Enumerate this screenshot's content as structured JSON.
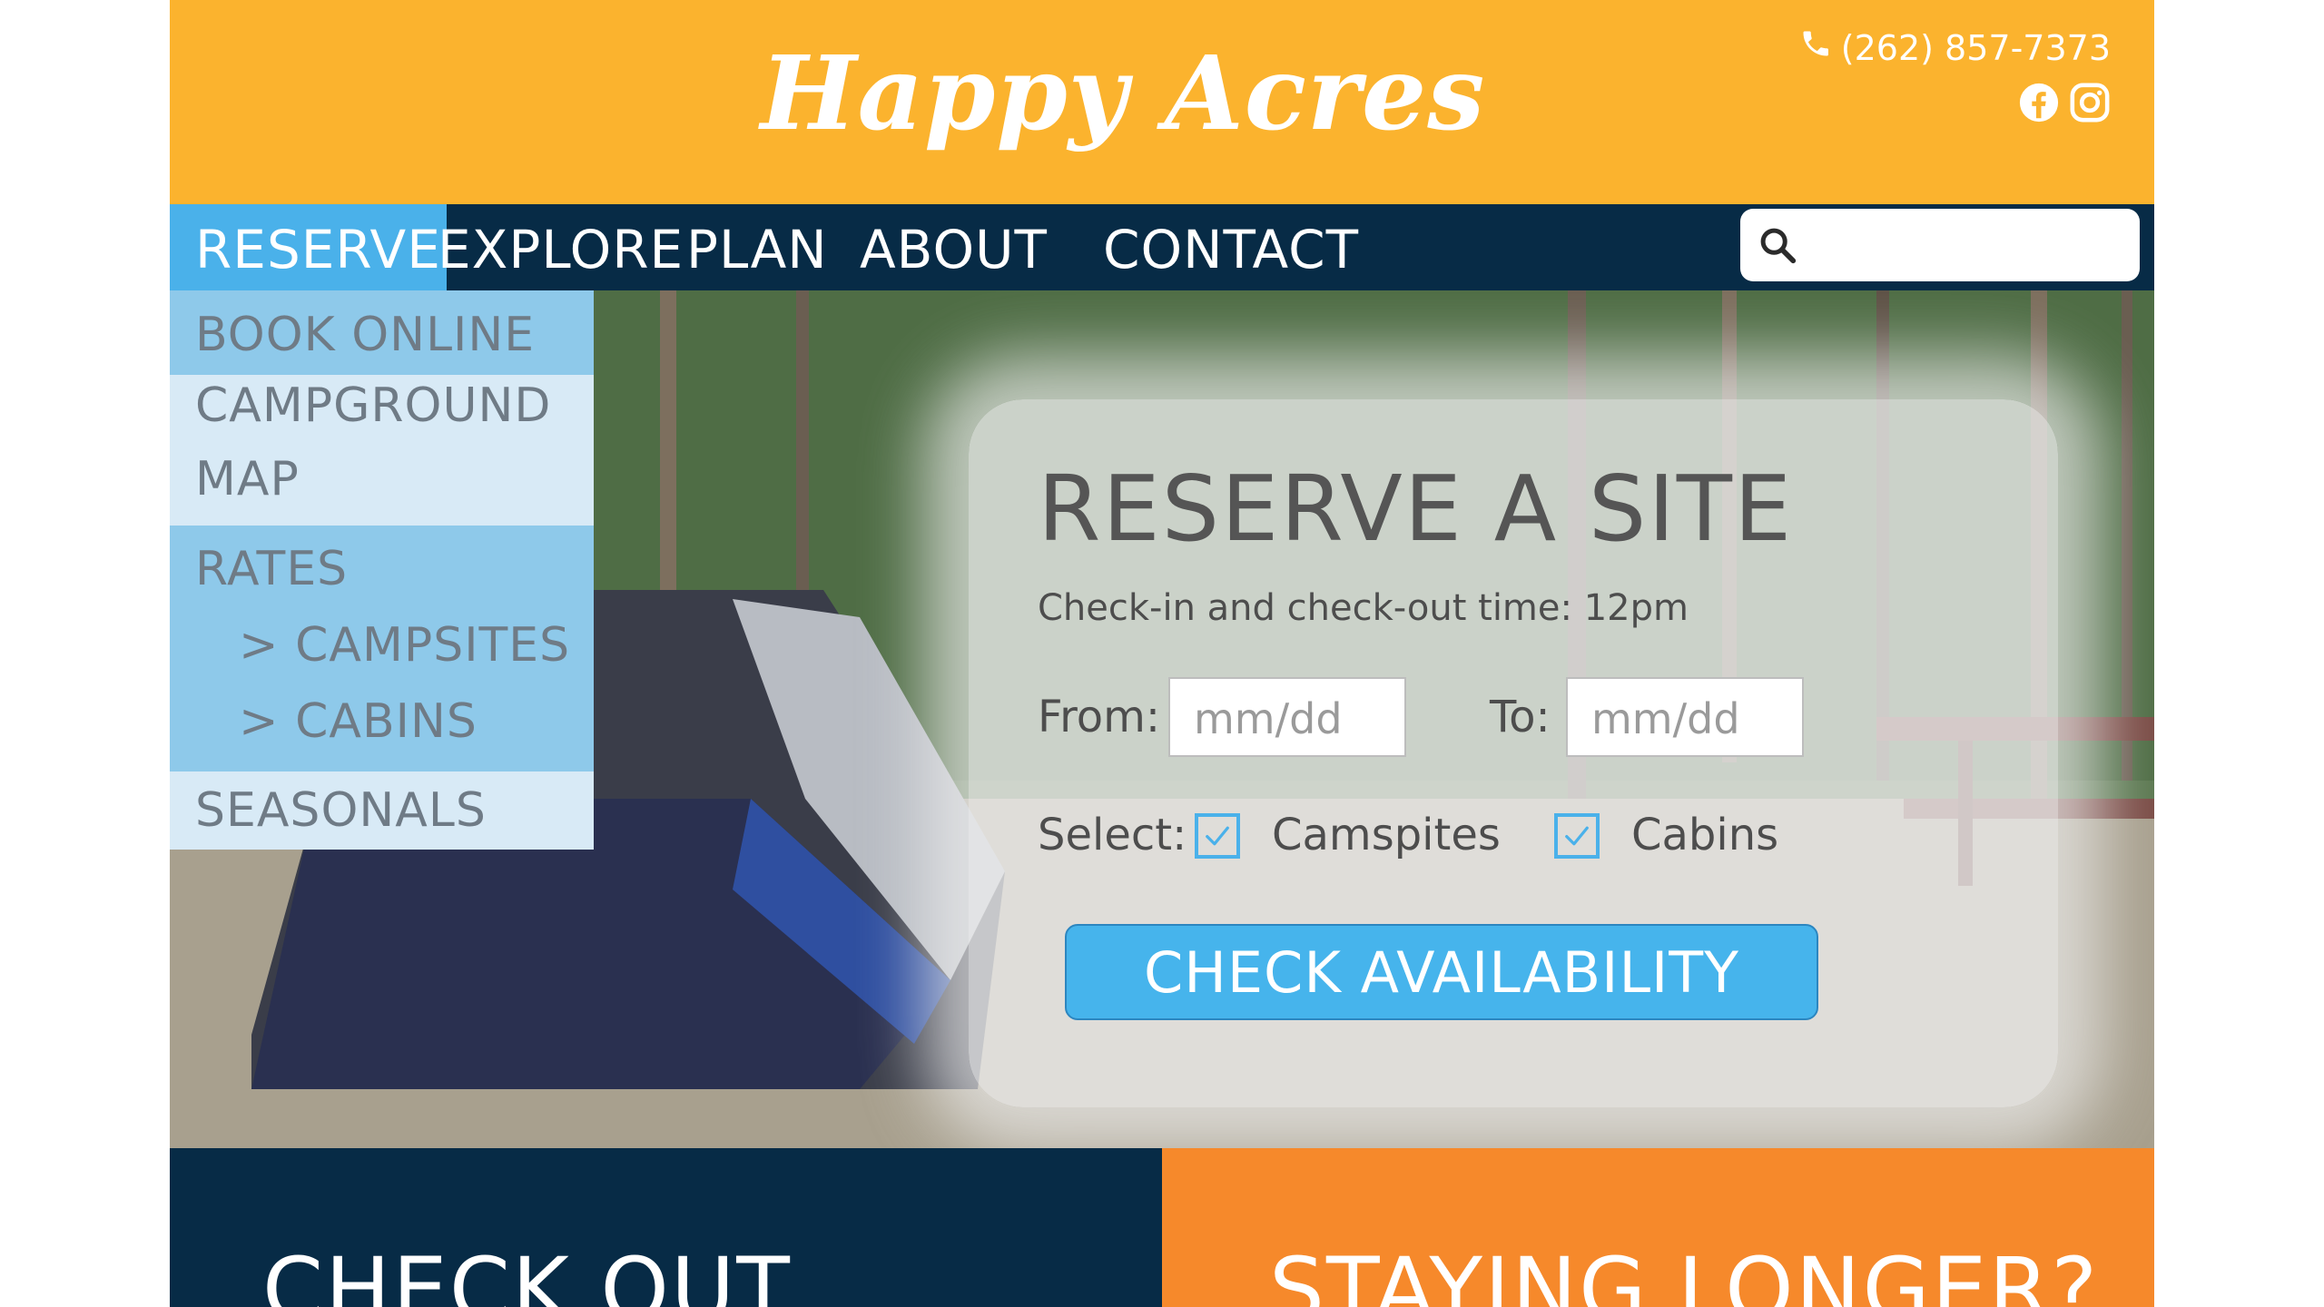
{
  "brand": {
    "name": "Happy Acres"
  },
  "header": {
    "phone": "(262) 857-7373",
    "social": [
      "facebook-icon",
      "instagram-icon"
    ]
  },
  "nav": {
    "items": [
      "RESERVE",
      "EXPLORE",
      "PLAN",
      "ABOUT",
      "CONTACT"
    ],
    "active": "RESERVE",
    "search_placeholder": ""
  },
  "dropdown": {
    "items": [
      {
        "label": "BOOK ONLINE"
      },
      {
        "label": "CAMPGROUND"
      },
      {
        "label": "MAP"
      },
      {
        "label": "RATES"
      },
      {
        "label": "> CAMPSITES"
      },
      {
        "label": "> CABINS"
      },
      {
        "label": "SEASONALS"
      }
    ]
  },
  "reserve": {
    "title": "RESERVE A SITE",
    "subtitle": "Check-in and check-out time: 12pm",
    "from_label": "From:",
    "from_placeholder": "mm/dd",
    "to_label": "To:",
    "to_placeholder": "mm/dd",
    "select_label": "Select:",
    "options": [
      {
        "label": "Camspites",
        "checked": true
      },
      {
        "label": "Cabins",
        "checked": true
      }
    ],
    "cta": "CHECK AVAILABILITY"
  },
  "panels": {
    "left": "CHECK OUT",
    "right": "STAYING LONGER?"
  },
  "colors": {
    "header": "#fbb32e",
    "nav": "#072b46",
    "accent": "#4ab1ea",
    "orange": "#f6892b"
  }
}
